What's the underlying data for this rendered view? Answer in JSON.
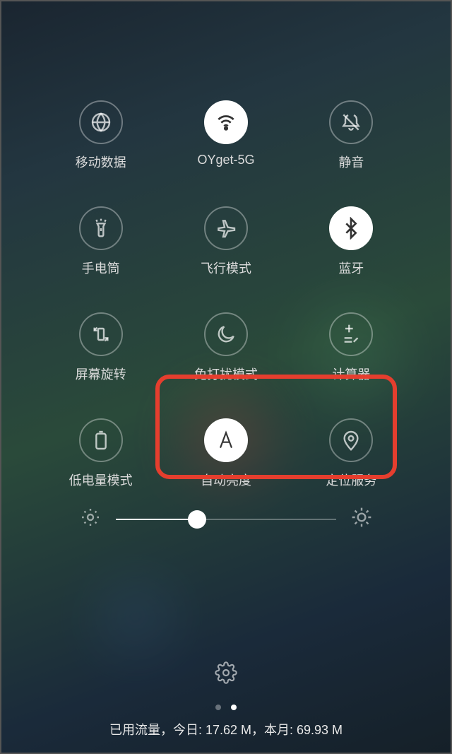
{
  "toggles": [
    {
      "id": "mobile-data",
      "label": "移动数据",
      "icon": "globe",
      "active": false
    },
    {
      "id": "wifi",
      "label": "OYget-5G",
      "icon": "wifi",
      "active": true
    },
    {
      "id": "mute",
      "label": "静音",
      "icon": "bell-off",
      "active": false
    },
    {
      "id": "flashlight",
      "label": "手电筒",
      "icon": "flashlight",
      "active": false
    },
    {
      "id": "airplane",
      "label": "飞行模式",
      "icon": "airplane",
      "active": false
    },
    {
      "id": "bluetooth",
      "label": "蓝牙",
      "icon": "bluetooth",
      "active": true
    },
    {
      "id": "rotation",
      "label": "屏幕旋转",
      "icon": "rotation",
      "active": false
    },
    {
      "id": "dnd",
      "label": "免打扰模式",
      "icon": "moon",
      "active": false
    },
    {
      "id": "calculator",
      "label": "计算器",
      "icon": "calc",
      "active": false
    },
    {
      "id": "low-power",
      "label": "低电量模式",
      "icon": "battery",
      "active": false
    },
    {
      "id": "auto-brightness",
      "label": "自动亮度",
      "icon": "letter-a",
      "active": true
    },
    {
      "id": "location",
      "label": "定位服务",
      "icon": "location",
      "active": false
    }
  ],
  "brightness": {
    "percent": 37
  },
  "highlight": {
    "rowStart": 3,
    "colStart": 1,
    "colSpan": 2
  },
  "page_indicator": {
    "count": 2,
    "active": 1
  },
  "data_usage": {
    "text": "已用流量，今日: 17.62 M，本月: 69.93 M"
  }
}
